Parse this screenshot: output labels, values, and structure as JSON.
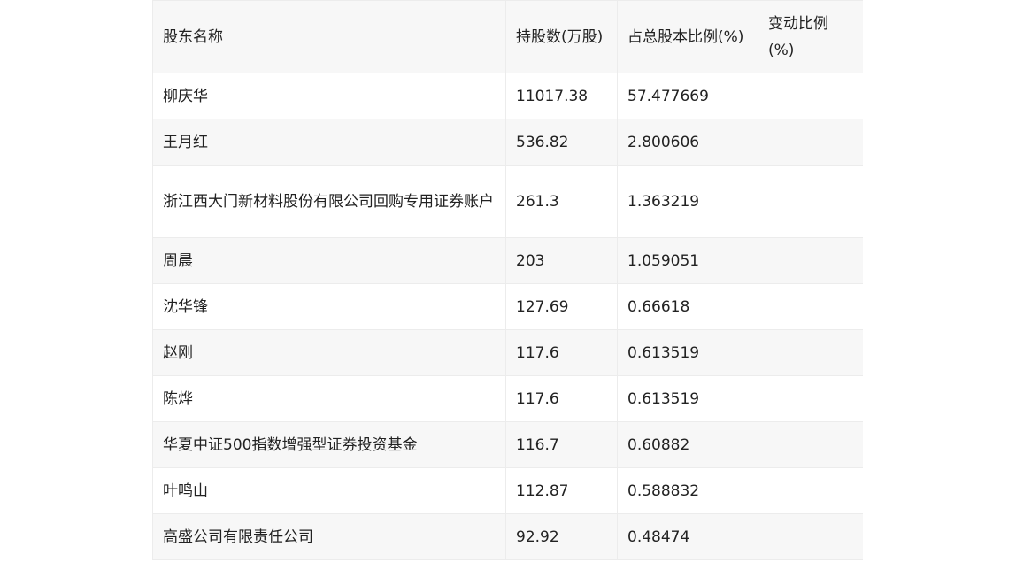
{
  "table": {
    "headers": [
      "股东名称",
      "持股数(万股)",
      "占总股本比例(%)",
      "变动比例(%)"
    ],
    "rows": [
      [
        "柳庆华",
        "11017.38",
        "57.477669",
        ""
      ],
      [
        "王月红",
        "536.82",
        "2.800606",
        ""
      ],
      [
        "浙江西大门新材料股份有限公司回购专用证券账户",
        "261.3",
        "1.363219",
        ""
      ],
      [
        "周晨",
        "203",
        "1.059051",
        ""
      ],
      [
        "沈华锋",
        "127.69",
        "0.66618",
        ""
      ],
      [
        "赵刚",
        "117.6",
        "0.613519",
        ""
      ],
      [
        "陈烨",
        "117.6",
        "0.613519",
        ""
      ],
      [
        "华夏中证500指数增强型证券投资基金",
        "116.7",
        "0.60882",
        ""
      ],
      [
        "叶鸣山",
        "112.87",
        "0.588832",
        ""
      ],
      [
        "高盛公司有限责任公司",
        "92.92",
        "0.48474",
        ""
      ]
    ]
  }
}
